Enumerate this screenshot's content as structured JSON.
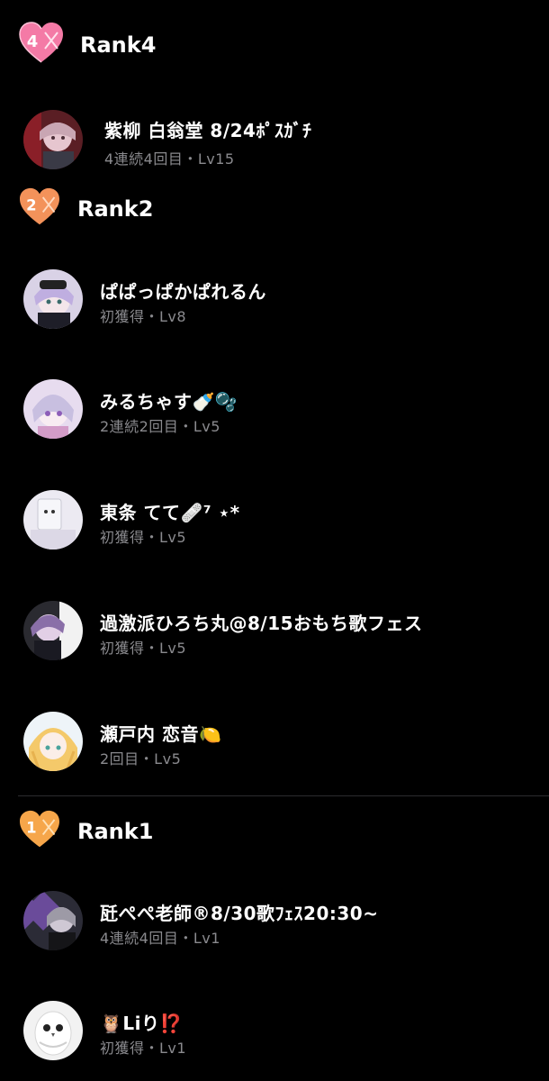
{
  "colors": {
    "background": "#000000",
    "text_primary": "#ffffff",
    "text_secondary": "#8a8a8e",
    "rank4_badge": "#f47aa6",
    "rank2_badge": "#f3925a",
    "rank1_badge": "#f6a64a",
    "divider": "#2c2c2e"
  },
  "sections": [
    {
      "title": "Rank4",
      "badge_digit": "4",
      "badge_icon": "heart-badge-icon",
      "users": [
        {
          "name": "紫柳 白翁堂 8/24ﾎﾟｽｶﾞﾁ",
          "meta": "4連続4回目・Lv15"
        }
      ]
    },
    {
      "title": "Rank2",
      "badge_digit": "2",
      "badge_icon": "heart-badge-icon",
      "users": [
        {
          "name": "ぱぱっぱかぱれるん",
          "meta": "初獲得・Lv8"
        },
        {
          "name": "みるちゃす🍼🫧",
          "meta": "2連続2回目・Lv5"
        },
        {
          "name": "東条 てて🩹⁷ ⋆*",
          "meta": "初獲得・Lv5"
        },
        {
          "name": "過激派ひろち丸@8/15おもち歌フェス",
          "meta": "初獲得・Lv5"
        },
        {
          "name": "瀬戸内 恋音🍋",
          "meta": "2回目・Lv5"
        }
      ]
    },
    {
      "title": "Rank1",
      "badge_digit": "1",
      "badge_icon": "heart-badge-icon",
      "users": [
        {
          "name": "瓩ぺぺ老師®8/30歌ﾌｪｽ20:30~",
          "meta": "4連続4回目・Lv1"
        },
        {
          "name": "🦉Liり⁉️",
          "meta": "初獲得・Lv1"
        }
      ]
    }
  ]
}
